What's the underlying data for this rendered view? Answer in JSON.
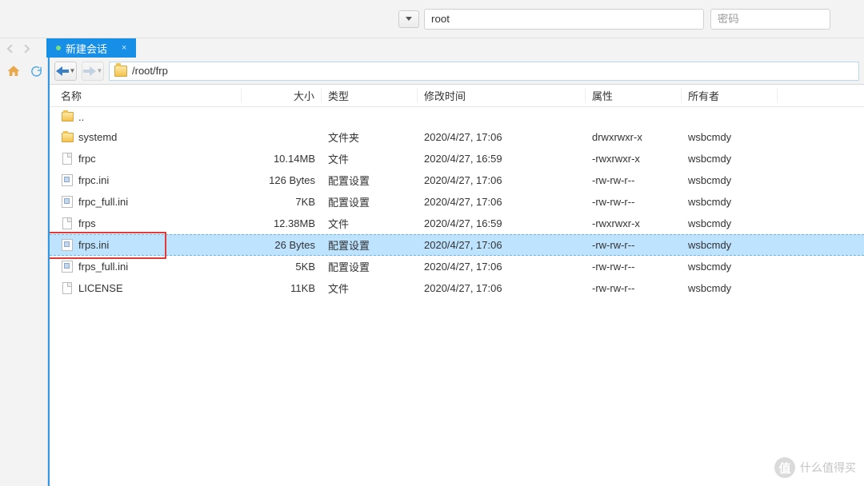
{
  "topbar": {
    "host_value": "root",
    "pwd_placeholder": "密码"
  },
  "tab": {
    "label": "新建会话",
    "close": "×"
  },
  "path": "/root/frp",
  "columns": {
    "name": "名称",
    "size": "大小",
    "type": "类型",
    "date": "修改时间",
    "attr": "属性",
    "owner": "所有者"
  },
  "parent_row": {
    "name": ".."
  },
  "rows": [
    {
      "icon": "folder",
      "name": "systemd",
      "size": "",
      "type": "文件夹",
      "date": "2020/4/27, 17:06",
      "attr": "drwxrwxr-x",
      "owner": "wsbcmdy",
      "selected": false
    },
    {
      "icon": "file",
      "name": "frpc",
      "size": "10.14MB",
      "type": "文件",
      "date": "2020/4/27, 16:59",
      "attr": "-rwxrwxr-x",
      "owner": "wsbcmdy",
      "selected": false
    },
    {
      "icon": "ini",
      "name": "frpc.ini",
      "size": "126 Bytes",
      "type": "配置设置",
      "date": "2020/4/27, 17:06",
      "attr": "-rw-rw-r--",
      "owner": "wsbcmdy",
      "selected": false
    },
    {
      "icon": "ini",
      "name": "frpc_full.ini",
      "size": "7KB",
      "type": "配置设置",
      "date": "2020/4/27, 17:06",
      "attr": "-rw-rw-r--",
      "owner": "wsbcmdy",
      "selected": false
    },
    {
      "icon": "file",
      "name": "frps",
      "size": "12.38MB",
      "type": "文件",
      "date": "2020/4/27, 16:59",
      "attr": "-rwxrwxr-x",
      "owner": "wsbcmdy",
      "selected": false
    },
    {
      "icon": "ini",
      "name": "frps.ini",
      "size": "26 Bytes",
      "type": "配置设置",
      "date": "2020/4/27, 17:06",
      "attr": "-rw-rw-r--",
      "owner": "wsbcmdy",
      "selected": true
    },
    {
      "icon": "ini",
      "name": "frps_full.ini",
      "size": "5KB",
      "type": "配置设置",
      "date": "2020/4/27, 17:06",
      "attr": "-rw-rw-r--",
      "owner": "wsbcmdy",
      "selected": false
    },
    {
      "icon": "file",
      "name": "LICENSE",
      "size": "11KB",
      "type": "文件",
      "date": "2020/4/27, 17:06",
      "attr": "-rw-rw-r--",
      "owner": "wsbcmdy",
      "selected": false
    }
  ],
  "watermark": {
    "badge": "值",
    "text": "什么值得买"
  }
}
